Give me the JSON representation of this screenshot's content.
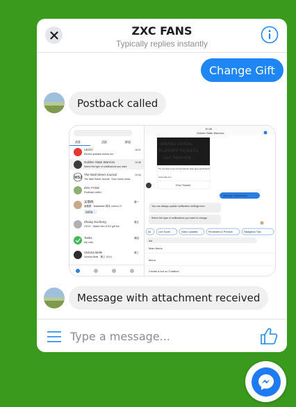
{
  "header": {
    "title": "ZXC FANS",
    "subtitle": "Typically replies instantly",
    "close_icon": "close-icon",
    "info_icon": "info-icon"
  },
  "messages": [
    {
      "direction": "outgoing",
      "text": "Change Gift"
    },
    {
      "direction": "incoming",
      "text": "Postback called"
    },
    {
      "direction": "incoming",
      "type": "image-attachment",
      "description_icon": "screenshot-image"
    },
    {
      "direction": "incoming",
      "text": "Message with attachment received"
    }
  ],
  "composer": {
    "placeholder": "Type a message...",
    "value": "",
    "menu_icon": "menu-icon",
    "like_icon": "thumbs-up-icon"
  },
  "launcher": {
    "icon": "messenger-icon"
  },
  "attachment_screenshot": {
    "status_time": "10:38",
    "conversation_title": "Golden State Warriors",
    "list": [
      {
        "name": "LEGO",
        "preview": "Recent question before me ·",
        "time": "16:47"
      },
      {
        "name": "Golden State Warriors",
        "preview": "Select the type of notifications you want",
        "time": "10:38"
      },
      {
        "name": "The Wall Street Journal",
        "preview": "The Wall Street Journal · Dow Jones Indus",
        "time": "10:34"
      },
      {
        "name": "ZXC FANS",
        "preview": "Postback called",
        "time": ""
      },
      {
        "name": "吴敬群",
        "preview": "吴敬群 · Basketball 球评 Lebron 27",
        "time": "周一"
      },
      {
        "name": "Zhang Xucheng",
        "preview": "LEGO · Watch the LEGO gift bot",
        "time": "周五"
      },
      {
        "name": "Tasks",
        "preview": "My Lists",
        "time": "周四"
      },
      {
        "name": "Victoria Belle",
        "preview": "Victoria Belle · 周三 23:41",
        "time": "周三"
      }
    ],
    "accept_label": "加好友",
    "ad": {
      "line1": "VERIFIED OFFICIAL",
      "line2": "PLAYOFF TICKETS",
      "line3": "- GET THEM NOW -",
      "caption": "The only place to buy and sell authentic single game playoff tickets",
      "url": "www.nba.com",
      "button": "Find Tickets"
    },
    "manage_label": "Manage notifications",
    "bot_text_1": "You can always update notification settings here.",
    "bot_text_2": "Select the type of notifications you want to change.",
    "quick_replies": [
      "All",
      "Live Score",
      "Video Updates",
      "Reminders & Preview",
      "Navigation Tips"
    ],
    "composer_placeholder": "Aa",
    "menu_title": "Main Menu",
    "menu_item": "Menu",
    "footer": "Create a bot on Chatfuel"
  }
}
